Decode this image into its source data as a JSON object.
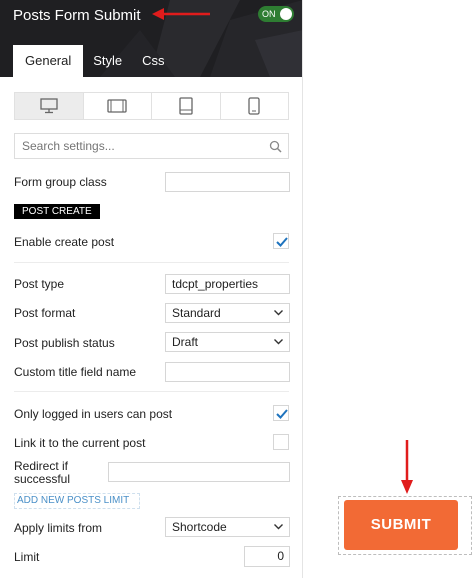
{
  "header": {
    "title": "Posts Form Submit",
    "toggle_label": "ON",
    "tabs": [
      {
        "label": "General",
        "active": true
      },
      {
        "label": "Style",
        "active": false
      },
      {
        "label": "Css",
        "active": false
      }
    ]
  },
  "devices": [
    "desktop-icon",
    "tablet-landscape-icon",
    "tablet-portrait-icon",
    "phone-icon"
  ],
  "search": {
    "placeholder": "Search settings..."
  },
  "form_group_class": {
    "label": "Form group class",
    "value": ""
  },
  "post_create": {
    "section_title": "POST CREATE",
    "enable_create_post": {
      "label": "Enable create post",
      "checked": true
    },
    "post_type": {
      "label": "Post type",
      "value": "tdcpt_properties"
    },
    "post_format": {
      "label": "Post format",
      "value": "Standard"
    },
    "post_publish_status": {
      "label": "Post publish status",
      "value": "Draft"
    },
    "custom_title_field_name": {
      "label": "Custom title field name",
      "value": ""
    },
    "only_logged_in": {
      "label": "Only logged in users can post",
      "checked": true
    },
    "link_current_post": {
      "label": "Link it to the current post",
      "checked": false
    },
    "redirect_if_successful": {
      "label_line1": "Redirect if",
      "label_line2": "successful",
      "value": ""
    }
  },
  "posts_limit": {
    "section_link": "ADD NEW POSTS LIMIT",
    "apply_limits_from": {
      "label": "Apply limits from",
      "value": "Shortcode"
    },
    "limit": {
      "label": "Limit",
      "value": "0"
    }
  },
  "preview": {
    "submit_label": "SUBMIT"
  },
  "colors": {
    "accent_orange": "#f26a35",
    "annotation_red": "#e01c1c",
    "toggle_green": "#2e7d32",
    "check_blue": "#1e73be"
  }
}
